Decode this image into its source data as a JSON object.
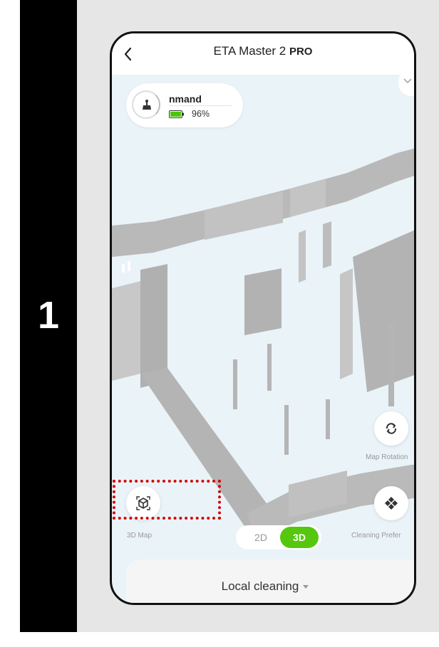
{
  "step": {
    "number": "1"
  },
  "header": {
    "title": "ETA Master 2",
    "title_suffix": "PRO"
  },
  "device": {
    "name": "nmand",
    "battery": "96%"
  },
  "controls": {
    "map_rotation_label": "Map Rotation",
    "map_3d_label": "3D Map",
    "cleaning_pref_label": "Cleaning Prefer"
  },
  "view_toggle": {
    "option_2d": "2D",
    "option_3d": "3D",
    "selected": "3D"
  },
  "bottom": {
    "mode_label": "Local cleaning"
  },
  "colors": {
    "accent_green": "#56c70f",
    "highlight_red": "#d40000",
    "map_floor": "#eaf3f8",
    "map_wall": "#b7b7b7"
  }
}
